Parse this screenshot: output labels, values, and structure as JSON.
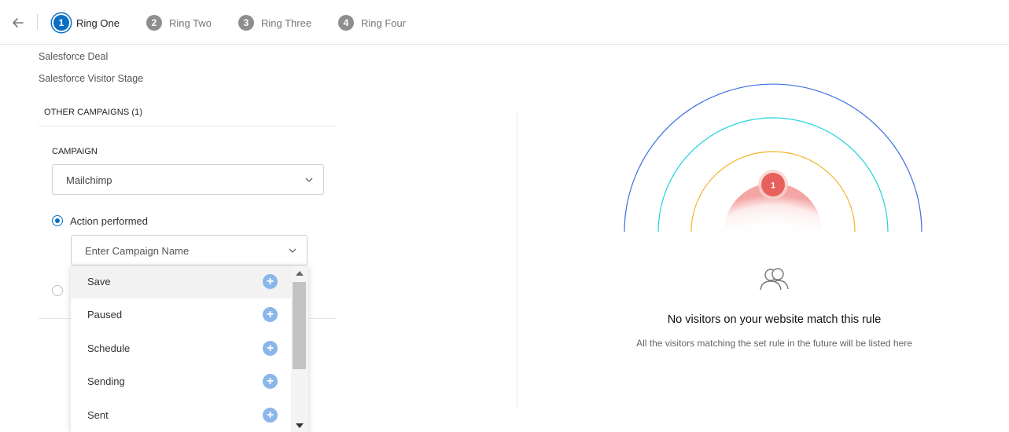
{
  "nav": {
    "back_icon": "arrow-left-icon",
    "steps": [
      {
        "num": "1",
        "label": "Ring One",
        "active": true
      },
      {
        "num": "2",
        "label": "Ring Two",
        "active": false
      },
      {
        "num": "3",
        "label": "Ring Three",
        "active": false
      },
      {
        "num": "4",
        "label": "Ring Four",
        "active": false
      }
    ]
  },
  "left": {
    "items": [
      "Salesforce Deal",
      "Salesforce Visitor Stage"
    ],
    "section_title": "OTHER CAMPAIGNS (1)",
    "campaign_label": "CAMPAIGN",
    "campaign_select": {
      "value": "Mailchimp"
    },
    "radio_action": {
      "label": "Action performed",
      "checked": true
    },
    "campaign_name_select": {
      "placeholder": "Enter Campaign Name"
    },
    "dropdown_options": [
      "Save",
      "Paused",
      "Schedule",
      "Sending",
      "Sent"
    ],
    "highlighted_option": "Save"
  },
  "right": {
    "ring_marker": "1",
    "empty_icon": "people-icon",
    "empty_title": "No visitors on your website match this rule",
    "empty_subtitle": "All the visitors matching the set rule in the future will be listed here"
  },
  "colors": {
    "accent": "#0a6fc2",
    "ring_outer": "#3a6fe0",
    "ring_middle": "#1ed2df",
    "ring_inner": "#f2b42a",
    "marker": "#e8605c",
    "plus": "#8ab6ea"
  }
}
